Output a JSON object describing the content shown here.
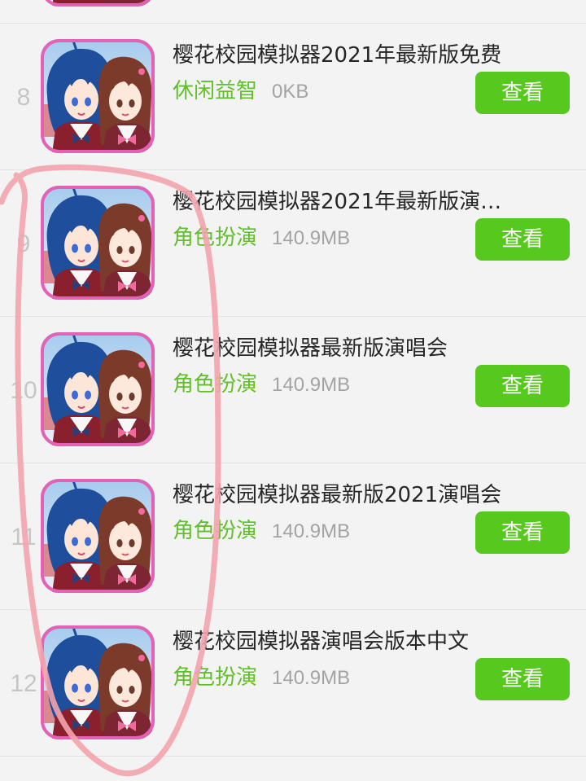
{
  "list": {
    "items": [
      {
        "rank": "8",
        "title": "樱花校园模拟器2021年最新版免费",
        "category": "休闲益智",
        "size": "0KB",
        "button": "查看",
        "icon": "anime-school-girls-app-icon"
      },
      {
        "rank": "9",
        "title": "樱花校园模拟器2021年最新版演…",
        "category": "角色扮演",
        "size": "140.9MB",
        "button": "查看",
        "icon": "anime-school-girls-app-icon"
      },
      {
        "rank": "10",
        "title": "樱花校园模拟器最新版演唱会",
        "category": "角色扮演",
        "size": "140.9MB",
        "button": "查看",
        "icon": "anime-school-girls-app-icon"
      },
      {
        "rank": "11",
        "title": "樱花校园模拟器最新版2021演唱会",
        "category": "角色扮演",
        "size": "140.9MB",
        "button": "查看",
        "icon": "anime-school-girls-app-icon"
      },
      {
        "rank": "12",
        "title": "樱花校园模拟器演唱会版本中文",
        "category": "角色扮演",
        "size": "140.9MB",
        "button": "查看",
        "icon": "anime-school-girls-app-icon"
      }
    ]
  },
  "annotation": {
    "type": "hand-drawn-circle",
    "icon": "pink-circle-annotation"
  },
  "colors": {
    "background": "#f3f3f3",
    "category_green": "#62bf2b",
    "button_green": "#57c81d",
    "annotation_pink": "#f3a3ad"
  }
}
